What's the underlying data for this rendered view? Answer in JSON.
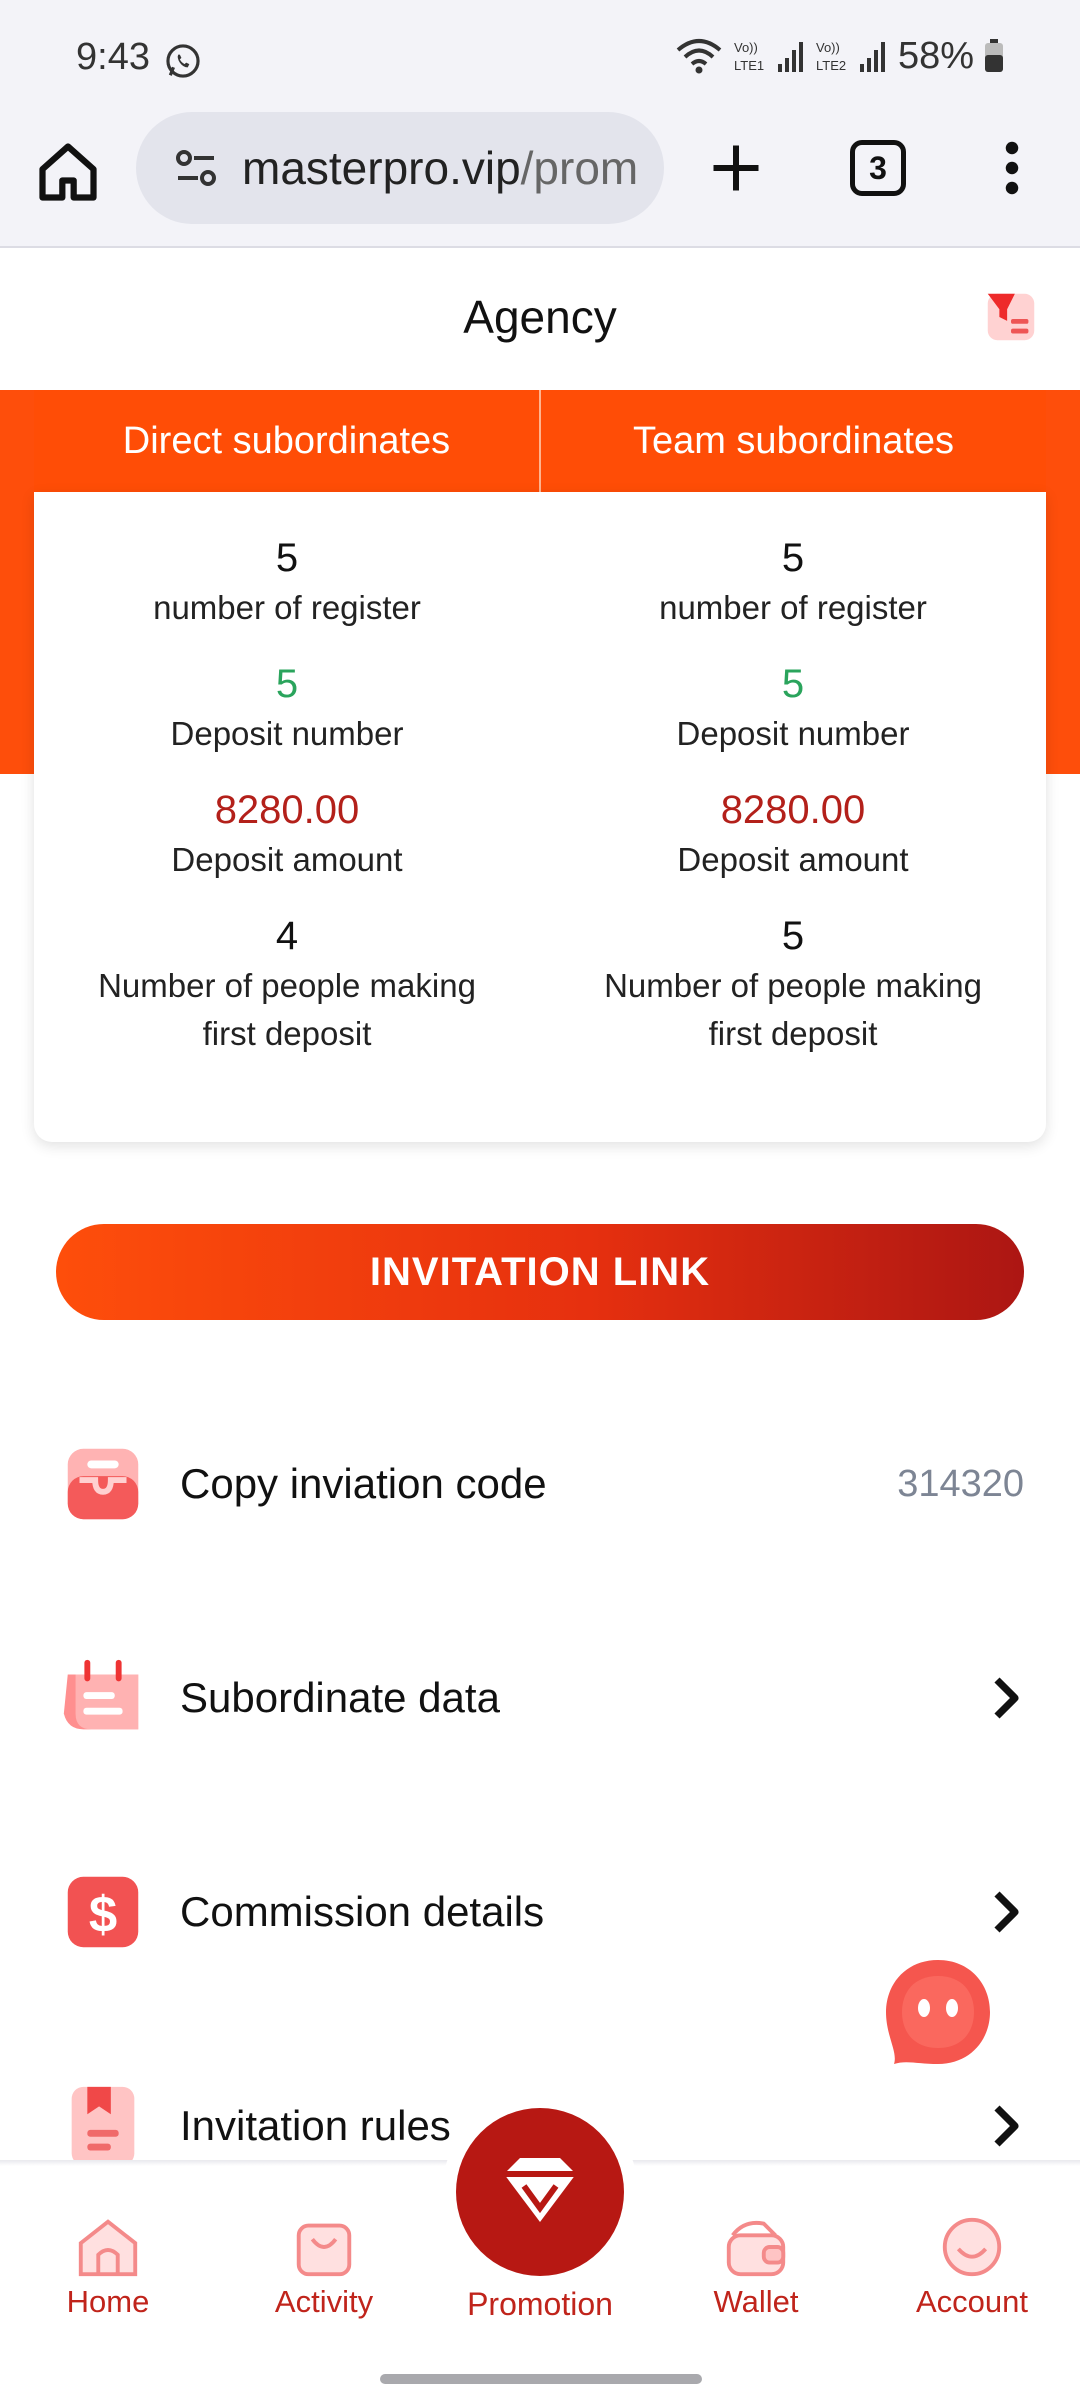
{
  "status_bar": {
    "time": "9:43",
    "battery": "58%",
    "icons": [
      "whatsapp-icon",
      "wifi-icon",
      "lte1-signal-icon",
      "lte2-signal-icon",
      "battery-icon"
    ]
  },
  "browser": {
    "url_main": "masterpro.vip",
    "url_rest": "/prom",
    "tab_count": "3"
  },
  "header": {
    "title": "Agency"
  },
  "tabs": [
    {
      "label": "Direct subordinates"
    },
    {
      "label": "Team subordinates"
    }
  ],
  "stats": {
    "direct": {
      "register_count": "5",
      "register_label": "number of register",
      "deposit_number": "5",
      "deposit_number_label": "Deposit number",
      "deposit_amount": "8280.00",
      "deposit_amount_label": "Deposit amount",
      "first_deposit_count": "4",
      "first_deposit_label": "Number of people making first deposit"
    },
    "team": {
      "register_count": "5",
      "register_label": "number of register",
      "deposit_number": "5",
      "deposit_number_label": "Deposit number",
      "deposit_amount": "8280.00",
      "deposit_amount_label": "Deposit amount",
      "first_deposit_count": "5",
      "first_deposit_label": "Number of people making first deposit"
    }
  },
  "invite_button": {
    "label": "INVITATION LINK"
  },
  "menu": [
    {
      "label": "Copy inviation code",
      "value": "314320",
      "icon": "inbox-icon"
    },
    {
      "label": "Subordinate data",
      "icon": "calendar-icon"
    },
    {
      "label": "Commission details",
      "icon": "dollar-icon"
    },
    {
      "label": "Invitation rules",
      "icon": "bookmark-document-icon"
    }
  ],
  "bottom_nav": {
    "items": [
      {
        "label": "Home",
        "icon": "home-icon"
      },
      {
        "label": "Activity",
        "icon": "gift-bag-icon"
      },
      {
        "label": "Promotion",
        "icon": "diamond-icon"
      },
      {
        "label": "Wallet",
        "icon": "wallet-icon"
      },
      {
        "label": "Account",
        "icon": "account-icon"
      }
    ]
  },
  "colors": {
    "brand_orange": "#fe4e0b",
    "brand_red": "#b71813",
    "green_value": "#2aa45c",
    "red_value": "#b3201a",
    "nav_label": "#c0241b"
  }
}
